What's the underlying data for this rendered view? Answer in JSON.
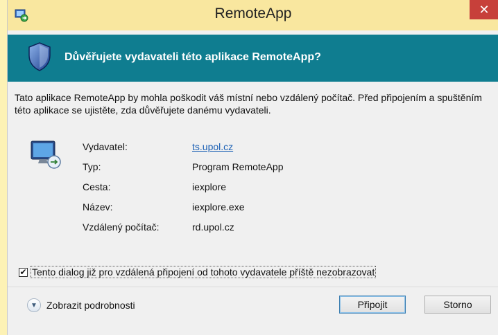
{
  "window": {
    "title": "RemoteApp",
    "close_symbol": "✕"
  },
  "header": {
    "question": "Důvěřujete vydavateli této aplikace RemoteApp?"
  },
  "warning": "Tato aplikace RemoteApp by mohla poškodit váš místní nebo vzdálený počítač. Před připojením a spuštěním této aplikace se ujistěte, zda důvěřujete danému vydavateli.",
  "details": [
    {
      "label": "Vydavatel:",
      "value": "ts.upol.cz",
      "is_link": true
    },
    {
      "label": "Typ:",
      "value": "Program RemoteApp"
    },
    {
      "label": "Cesta:",
      "value": "iexplore"
    },
    {
      "label": "Název:",
      "value": "iexplore.exe"
    },
    {
      "label": "Vzdálený počítač:",
      "value": "rd.upol.cz"
    }
  ],
  "checkbox": {
    "checked": true,
    "label": "Tento dialog již pro vzdálená připojení od tohoto vydavatele příště nezobrazovat"
  },
  "footer": {
    "details_toggle": "Zobrazit podrobnosti",
    "connect_label": "Připojit",
    "cancel_label": "Storno"
  },
  "icons": {
    "app": "remoteapp-icon",
    "shield": "shield-icon",
    "computer": "remote-computer-icon",
    "chevron": "chevron-down-icon"
  },
  "colors": {
    "header_band": "#0f7d90",
    "title_bar": "#f9e79f",
    "close": "#c7403a",
    "link": "#1a5fb4"
  }
}
